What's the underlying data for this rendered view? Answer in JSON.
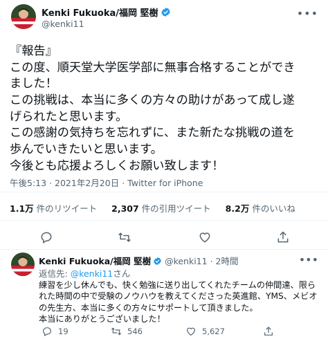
{
  "tweet": {
    "author_name": "Kenki Fukuoka/福岡 堅樹",
    "author_handle": "@kenki11",
    "text_lines": [
      "『報告』",
      "この度、順天堂大学医学部に無事合格することができ",
      "ました！",
      "この挑戦は、本当に多くの方々の助けがあって成し遂",
      "げられたと思います。",
      "この感謝の気持ちを忘れずに、また新たな挑戦の道を",
      "歩んでいきたいと思います。",
      "今後とも応援よろしくお願い致します！"
    ],
    "time": "午後5:13",
    "separator": "·",
    "date": "2021年2月20日",
    "source": "Twitter for iPhone",
    "stats": {
      "retweets_count": "1.1万",
      "retweets_label": "件のリツイート",
      "quotes_count": "2,307",
      "quotes_label": "件の引用ツイート",
      "likes_count": "8.2万",
      "likes_label": "件のいいね"
    },
    "more_icon": "more-dots-icon"
  },
  "reply": {
    "author_name": "Kenki Fukuoka/福岡 堅樹",
    "author_handle": "@kenki11",
    "time_ago": "2時間",
    "separator": "·",
    "replying_prefix": "返信先:",
    "replying_to": "@kenki11",
    "replying_suffix": "さん",
    "text_lines": [
      "練習を少し休んでも、快く勉強に送り出してくれたチームの仲間達、限ら",
      "れた時間の中で受験のノウハウを教えてくださった英進館、YMS、メビオ",
      "の先生方、本当に多くの方々にサポートして頂きました。",
      "本当にありがとうございました！"
    ],
    "reply_count": "19",
    "retweet_count": "546",
    "like_count": "5,627"
  },
  "colors": {
    "accent": "#1d9bf0",
    "secondary_text": "#536471",
    "divider": "#eff3f4"
  }
}
